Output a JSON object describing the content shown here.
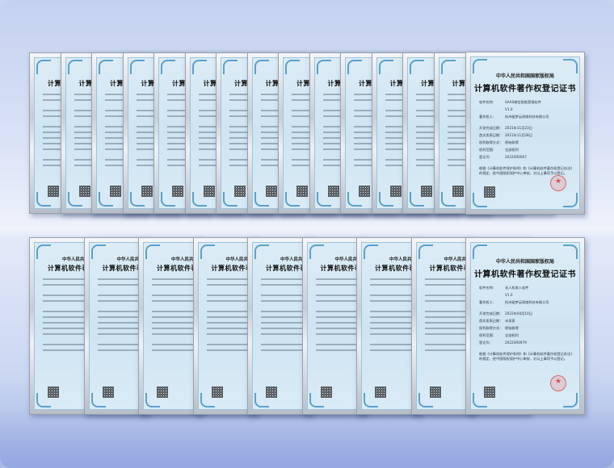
{
  "certificate": {
    "issuer": "中华人民共和国国家版权局",
    "title": "计算机软件著作权登记证书",
    "fields": [
      {
        "label": "软件名称：",
        "value": "SAAS微信智能营销软件"
      },
      {
        "label": "",
        "value": "V1.0"
      },
      {
        "label": "著作权人：",
        "value": "杭州骏梦云网络科技有限公司"
      },
      {
        "label": "开发完成日期：",
        "value": "2021年11月23日"
      },
      {
        "label": "首次发表日期：",
        "value": "2021年11月28日"
      },
      {
        "label": "权利取得方式：",
        "value": "原始取得"
      },
      {
        "label": "权利范围：",
        "value": "全部权利"
      },
      {
        "label": "登记号：",
        "value": "2022SR0007"
      }
    ],
    "note": "根据《计算机软件保护条例》和《计算机软件著作权登记办法》的规定，经中国版权保护中心审核，对以上事项予以登记。"
  },
  "certificate_bottom": {
    "issuer": "中华人民共和国国家版权局",
    "title": "计算机软件著作权登记证书",
    "fields": [
      {
        "label": "软件名称：",
        "value": "无人机收入软件"
      },
      {
        "label": "",
        "value": "V1.0"
      },
      {
        "label": "著作权人：",
        "value": "杭州骏梦云网络科技有限公司"
      },
      {
        "label": "开发完成日期：",
        "value": "2022年04月10日"
      },
      {
        "label": "首次发表日期：",
        "value": "未发表"
      },
      {
        "label": "权利取得方式：",
        "value": "原始取得"
      },
      {
        "label": "权利范围：",
        "value": "全部权利"
      },
      {
        "label": "登记号：",
        "value": "2022SR0979"
      }
    ],
    "note": "根据《计算机软件保护条例》和《计算机软件著作权登记办法》的规定，经中国版权保护中心审核，对以上事项予以登记。"
  },
  "colors": {
    "background_top": "#c4d1f0",
    "background_bottom": "#9fb1e2",
    "frame": "#c9ced6",
    "paper": "#d6e8f4",
    "seal": "#d73c3c"
  }
}
